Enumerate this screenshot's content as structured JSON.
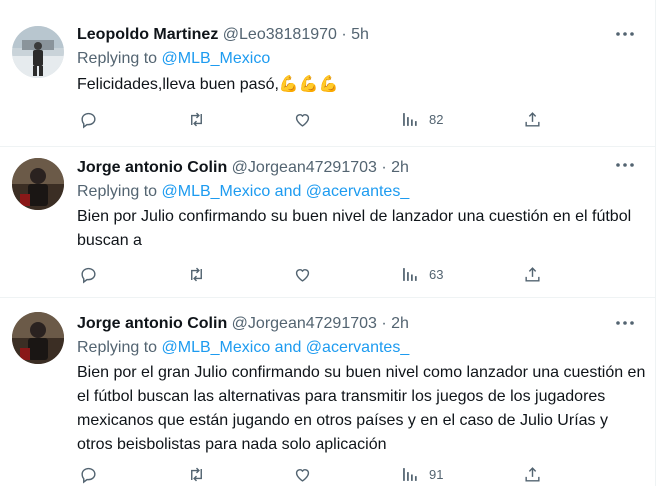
{
  "tweets": [
    {
      "name": "Leopoldo Martinez",
      "handle": "@Leo38181970",
      "dot": "·",
      "time": "5h",
      "replying_prefix": "Replying to ",
      "replying_to": "@MLB_Mexico",
      "text": "Felicidades,lleva buen pasó,💪💪💪",
      "views": "82"
    },
    {
      "name": "Jorge antonio Colin",
      "handle": "@Jorgean47291703",
      "dot": "·",
      "time": "2h",
      "replying_prefix": "Replying to ",
      "replying_to": "@MLB_Mexico and @acervantes_",
      "text": "Bien por Julio confirmando su buen nivel de lanzador una cuestión en el fútbol buscan a",
      "views": "63"
    },
    {
      "name": "Jorge antonio Colin",
      "handle": "@Jorgean47291703",
      "dot": "·",
      "time": "2h",
      "replying_prefix": "Replying to ",
      "replying_to": "@MLB_Mexico and @acervantes_",
      "text": "Bien por el gran Julio confirmando su buen nivel como lanzador una cuestión en el fútbol buscan las alternativas para transmitir los juegos de los jugadores mexicanos que están jugando en otros países y en el caso de Julio Urías y otros beisbolistas para nada solo aplicación",
      "views": "91"
    }
  ],
  "icons": {
    "more": "more-icon",
    "reply": "reply-icon",
    "retweet": "retweet-icon",
    "like": "heart-icon",
    "views": "views-icon",
    "share": "share-icon"
  },
  "colors": {
    "link": "#1d9bf0",
    "secondary_text": "#536471",
    "primary_text": "#0f1419",
    "divider": "#eff3f4"
  }
}
